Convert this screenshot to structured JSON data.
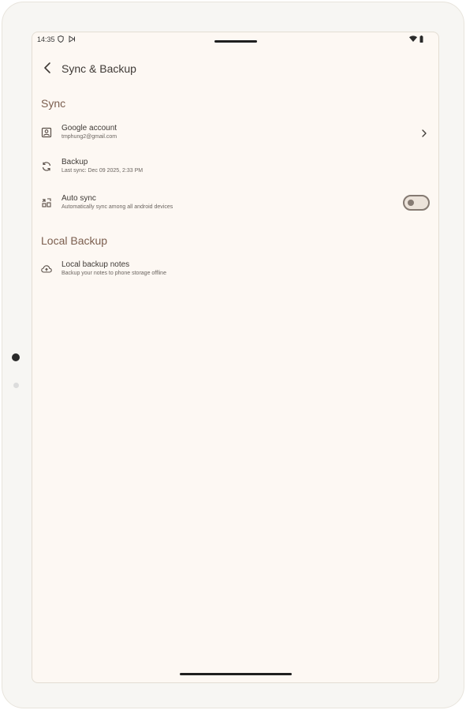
{
  "status": {
    "time": "14:35"
  },
  "appbar": {
    "title": "Sync & Backup",
    "back_icon": "arrow-back-icon"
  },
  "sync_section": {
    "title": "Sync",
    "items": [
      {
        "label": "Google account",
        "sub": "tmphung2@gmail.com",
        "icon": "account-box-icon"
      },
      {
        "label": "Backup",
        "sub": "Last sync: Dec 09 2025, 2:33 PM",
        "icon": "sync-icon"
      },
      {
        "label": "Auto sync",
        "sub": "Automatically sync among all android devices",
        "icon": "auto-sync-icon",
        "toggle_on": false
      }
    ]
  },
  "local_section": {
    "title": "Local Backup",
    "items": [
      {
        "label": "Local backup notes",
        "sub": "Backup your notes to phone storage offline",
        "icon": "cloud-upload-icon"
      }
    ]
  },
  "colors": {
    "background": "#fdf8f3",
    "section_title": "#7b5e4e",
    "text_primary": "#3f3a36",
    "toggle_outline": "#857a72"
  }
}
